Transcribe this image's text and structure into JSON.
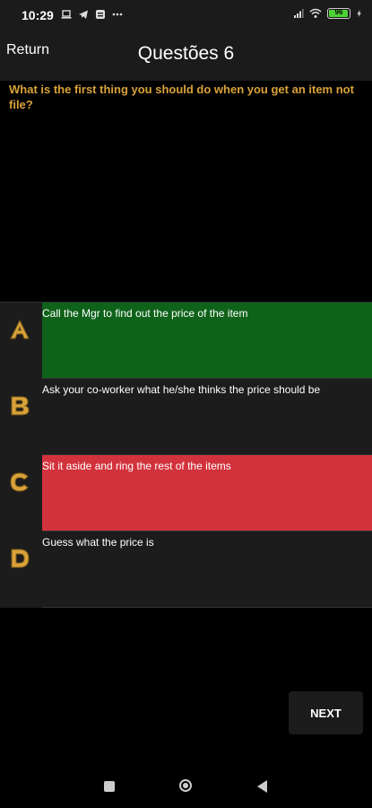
{
  "status_bar": {
    "time": "10:29",
    "battery": "96",
    "icons": [
      "laptop-icon",
      "telegram-icon",
      "notification-icon",
      "more-dots-icon",
      "signal-icon",
      "wifi-icon",
      "battery-icon",
      "charging-icon"
    ]
  },
  "header": {
    "back_label": "Return",
    "title": "Questões 6"
  },
  "question": {
    "text": "What is the first thing you should do when you get an item not file?"
  },
  "options": [
    {
      "letter": "A",
      "text": "Call the Mgr to find out the price of the item",
      "state": "correct",
      "color": "#0e6219"
    },
    {
      "letter": "B",
      "text": "Ask your co-worker what he/she thinks the price should be",
      "state": "neutral",
      "color": "#1c1c1c"
    },
    {
      "letter": "C",
      "text": "Sit it aside and ring the rest of the items",
      "state": "wrong",
      "color": "#d2323c"
    },
    {
      "letter": "D",
      "text": "Guess what the price is",
      "state": "neutral",
      "color": "#1c1c1c"
    }
  ],
  "next_label": "NEXT",
  "colors": {
    "question": "#d9a23a",
    "letter_gold": "#d9a23a"
  }
}
